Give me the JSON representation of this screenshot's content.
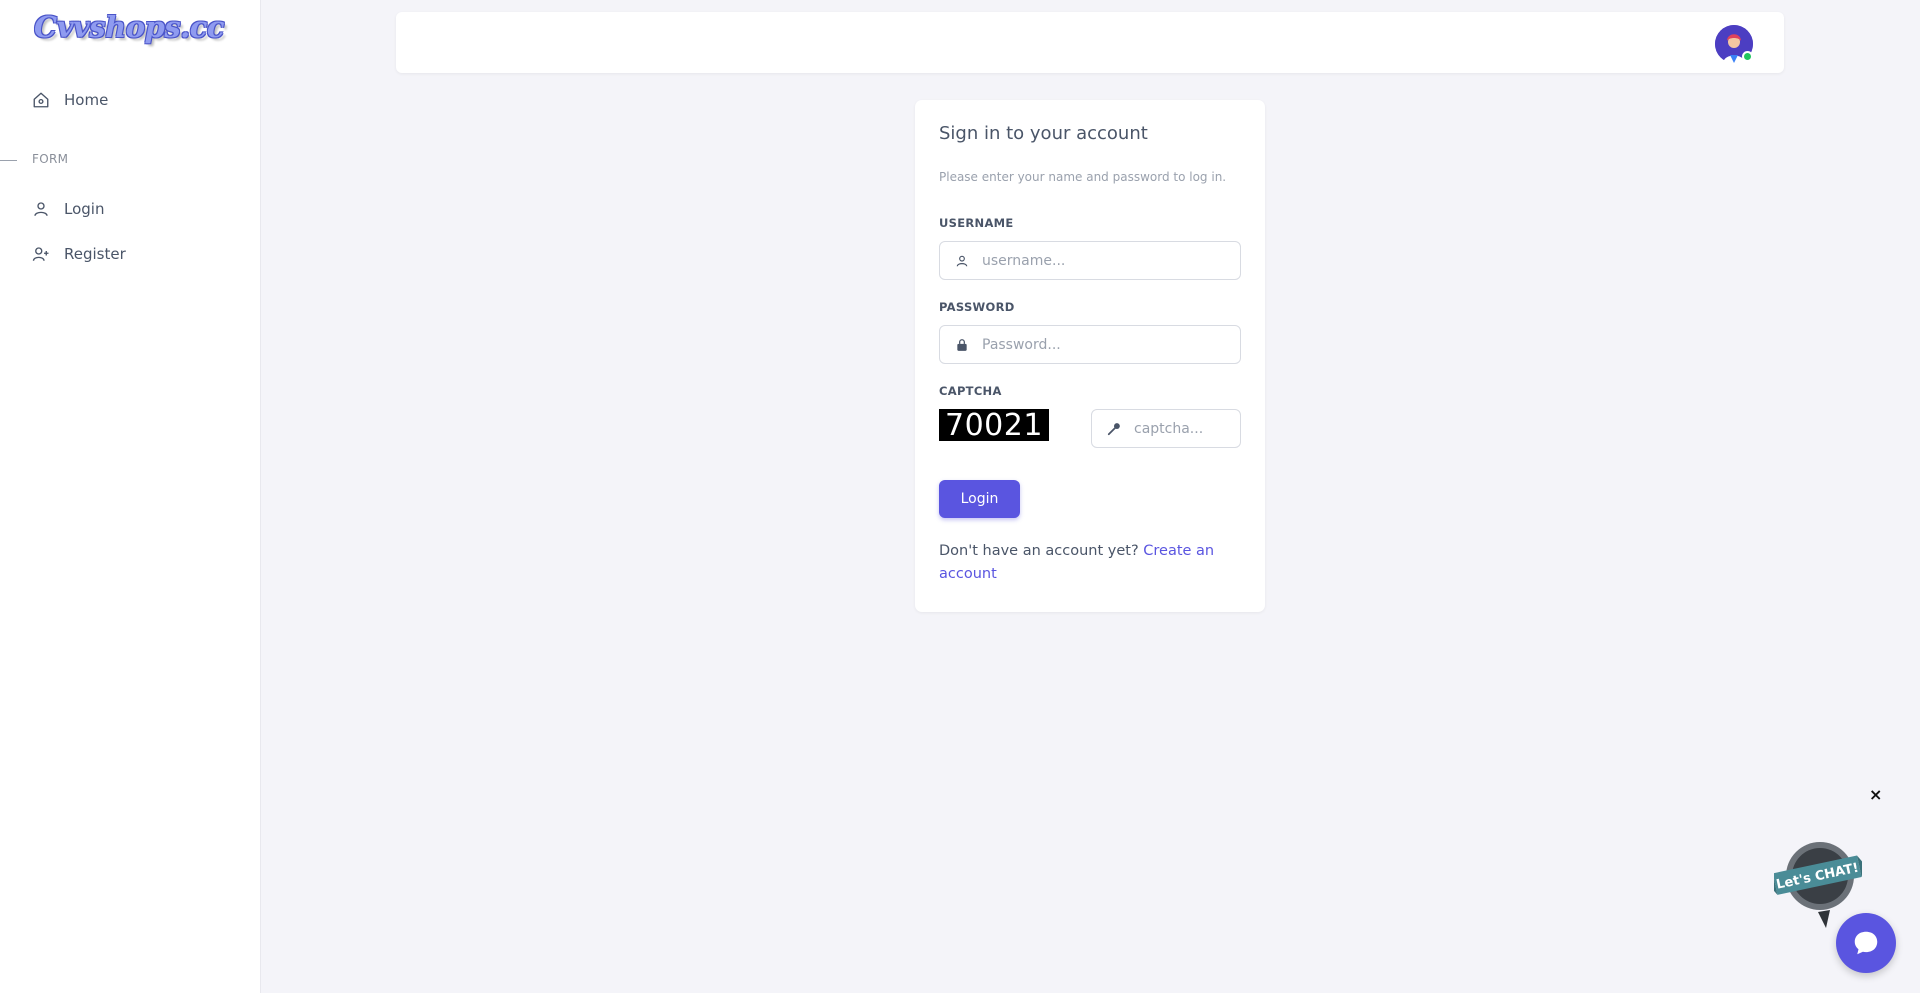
{
  "sidebar": {
    "logo": "Cvvshops.cc",
    "home_label": "Home",
    "section_label": "FORM",
    "items": [
      {
        "label": "Login"
      },
      {
        "label": "Register"
      }
    ]
  },
  "card": {
    "title": "Sign in to your account",
    "subtitle": "Please enter your name and password to log in.",
    "username_label": "USERNAME",
    "username_placeholder": "username...",
    "password_label": "PASSWORD",
    "password_placeholder": "Password...",
    "captcha_label": "CAPTCHA",
    "captcha_code": "70021",
    "captcha_placeholder": "captcha...",
    "login_button": "Login",
    "footer_text": "Don't have an account yet? ",
    "create_link": "Create an account"
  },
  "chat": {
    "close": "×",
    "bubble_text": "Let's CHAT!"
  },
  "colors": {
    "accent": "#5a55e0",
    "background": "#f4f4f9",
    "online": "#22c55e"
  }
}
